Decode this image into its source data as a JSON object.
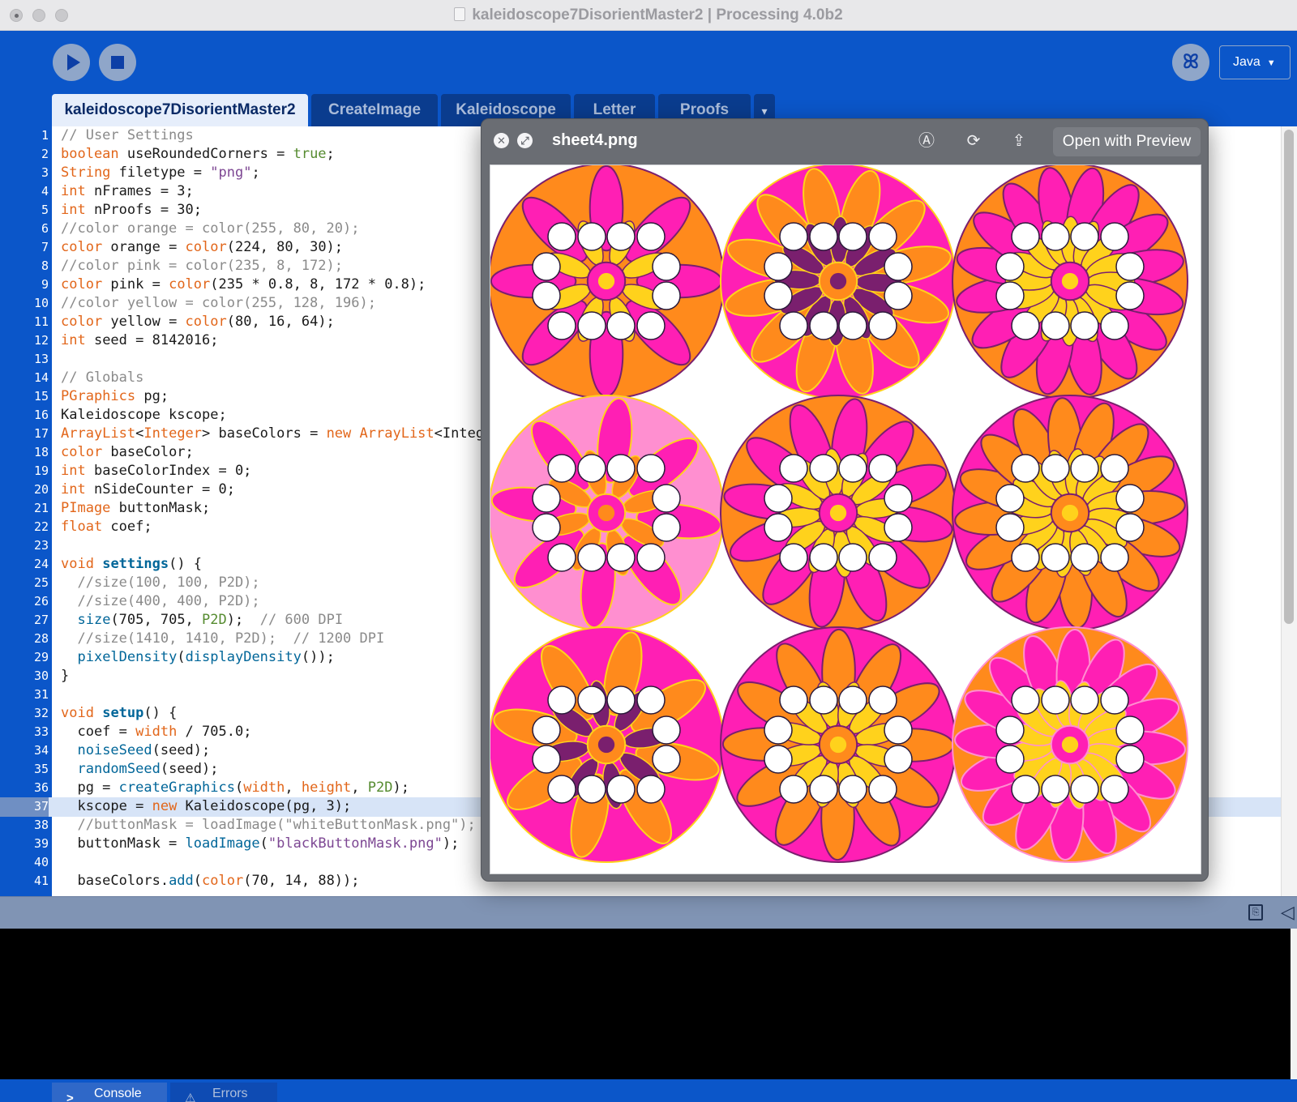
{
  "window": {
    "title": "kaleidoscope7DisorientMaster2 | Processing 4.0b2"
  },
  "toolbar": {
    "run_icon": "play-icon",
    "stop_icon": "stop-icon",
    "debug_icon": "debugger-icon",
    "mode_label": "Java"
  },
  "tabs": [
    {
      "label": "kaleidoscope7DisorientMaster2",
      "active": true
    },
    {
      "label": "CreateImage",
      "active": false
    },
    {
      "label": "Kaleidoscope",
      "active": false
    },
    {
      "label": "Letter",
      "active": false
    },
    {
      "label": "Proofs",
      "active": false
    }
  ],
  "tab_menu_label": "▾",
  "editor": {
    "highlighted_line": 37,
    "lines": [
      {
        "n": "1",
        "code": "// User Settings"
      },
      {
        "n": "2",
        "code": "boolean useRoundedCorners = true;"
      },
      {
        "n": "3",
        "code": "String filetype = \"png\";"
      },
      {
        "n": "4",
        "code": "int nFrames = 3;"
      },
      {
        "n": "5",
        "code": "int nProofs = 30;"
      },
      {
        "n": "6",
        "code": "//color orange = color(255, 80, 20);"
      },
      {
        "n": "7",
        "code": "color orange = color(224, 80, 30);"
      },
      {
        "n": "8",
        "code": "//color pink = color(235, 8, 172);"
      },
      {
        "n": "9",
        "code": "color pink = color(235 * 0.8, 8, 172 * 0.8);"
      },
      {
        "n": "10",
        "code": "//color yellow = color(255, 128, 196);"
      },
      {
        "n": "11",
        "code": "color yellow = color(80, 16, 64);"
      },
      {
        "n": "12",
        "code": "int seed = 8142016;"
      },
      {
        "n": "13",
        "code": ""
      },
      {
        "n": "14",
        "code": "// Globals"
      },
      {
        "n": "15",
        "code": "PGraphics pg;"
      },
      {
        "n": "16",
        "code": "Kaleidoscope kscope;"
      },
      {
        "n": "17",
        "code": "ArrayList<Integer> baseColors = new ArrayList<Integ"
      },
      {
        "n": "18",
        "code": "color baseColor;"
      },
      {
        "n": "19",
        "code": "int baseColorIndex = 0;"
      },
      {
        "n": "20",
        "code": "int nSideCounter = 0;"
      },
      {
        "n": "21",
        "code": "PImage buttonMask;"
      },
      {
        "n": "22",
        "code": "float coef;"
      },
      {
        "n": "23",
        "code": ""
      },
      {
        "n": "24",
        "code": "void settings() {"
      },
      {
        "n": "25",
        "code": "  //size(100, 100, P2D);"
      },
      {
        "n": "26",
        "code": "  //size(400, 400, P2D);"
      },
      {
        "n": "27",
        "code": "  size(705, 705, P2D);  // 600 DPI"
      },
      {
        "n": "28",
        "code": "  //size(1410, 1410, P2D);  // 1200 DPI"
      },
      {
        "n": "29",
        "code": "  pixelDensity(displayDensity());"
      },
      {
        "n": "30",
        "code": "}"
      },
      {
        "n": "31",
        "code": ""
      },
      {
        "n": "32",
        "code": "void setup() {"
      },
      {
        "n": "33",
        "code": "  coef = width / 705.0;"
      },
      {
        "n": "34",
        "code": "  noiseSeed(seed);"
      },
      {
        "n": "35",
        "code": "  randomSeed(seed);"
      },
      {
        "n": "36",
        "code": "  pg = createGraphics(width, height, P2D);"
      },
      {
        "n": "37",
        "code": "  kscope = new Kaleidoscope(pg, 3);"
      },
      {
        "n": "38",
        "code": "  //buttonMask = loadImage(\"whiteButtonMask.png\");"
      },
      {
        "n": "39",
        "code": "  buttonMask = loadImage(\"blackButtonMask.png\");"
      },
      {
        "n": "40",
        "code": ""
      },
      {
        "n": "41",
        "code": "  baseColors.add(color(70, 14, 88));"
      }
    ]
  },
  "syntax_colors": {
    "keyword": "#e2661a",
    "function": "#006699",
    "string": "#7d4793",
    "comment": "#8a8a8a",
    "literal": "#558b2f",
    "number": "#1a1a1a"
  },
  "console": {
    "copy_icon": "copy-icon",
    "collapse_icon": "collapse-icon",
    "tabs": [
      {
        "label": "Console",
        "icon": "console-icon",
        "active": true
      },
      {
        "label": "Errors",
        "icon": "warning-icon",
        "active": false
      }
    ]
  },
  "quicklook": {
    "title": "sheet4.png",
    "open_label": "Open with Preview",
    "buttons": [
      "close-icon",
      "fullscreen-icon",
      "markup-icon",
      "rotate-icon",
      "share-icon"
    ],
    "image": {
      "rows": 3,
      "cols": 3,
      "colors": {
        "pink": "#ff1fb4",
        "orange": "#ff8a1c",
        "yellow": "#ffd21c",
        "purple": "#7a1f6e",
        "light_pink": "#ff8fd0",
        "white": "#ffffff"
      }
    }
  }
}
